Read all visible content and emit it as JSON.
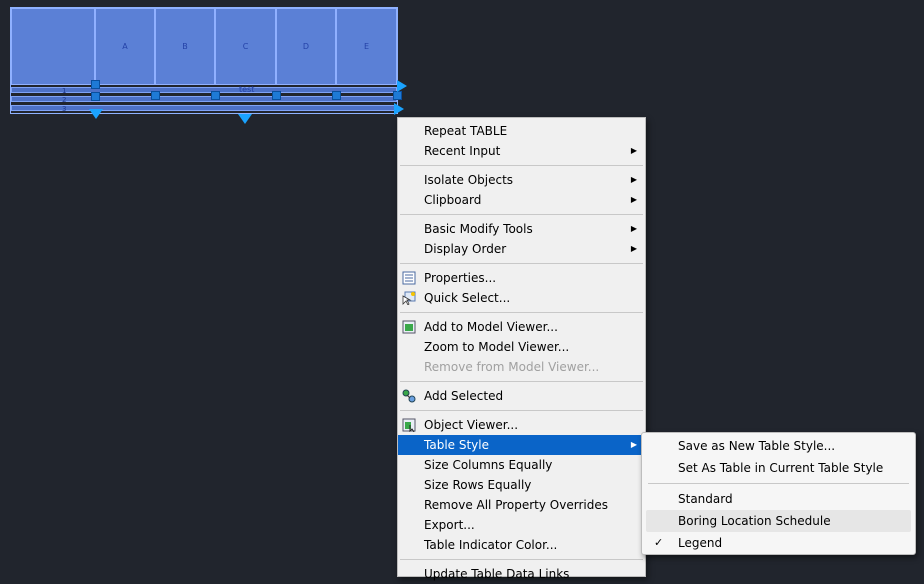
{
  "table": {
    "columns": [
      "A",
      "B",
      "C",
      "D",
      "E"
    ],
    "rows": [
      "1",
      "2",
      "3"
    ],
    "cell_text": "test"
  },
  "context_menu": {
    "items": [
      {
        "label": "Repeat TABLE"
      },
      {
        "label": "Recent Input",
        "submenu": true
      },
      {
        "label": "Isolate Objects",
        "submenu": true
      },
      {
        "label": "Clipboard",
        "submenu": true
      },
      {
        "label": "Basic Modify Tools",
        "submenu": true
      },
      {
        "label": "Display Order",
        "submenu": true
      },
      {
        "label": "Properties...",
        "icon": "properties-icon"
      },
      {
        "label": "Quick Select...",
        "icon": "quick-select-icon"
      },
      {
        "label": "Add to Model Viewer...",
        "icon": "model-viewer-icon"
      },
      {
        "label": "Zoom to Model Viewer..."
      },
      {
        "label": "Remove from Model Viewer...",
        "disabled": true
      },
      {
        "label": "Add Selected",
        "icon": "add-selected-icon"
      },
      {
        "label": "Object Viewer...",
        "icon": "object-viewer-icon"
      },
      {
        "label": "Table Style",
        "submenu": true,
        "active": true
      },
      {
        "label": "Size Columns Equally"
      },
      {
        "label": "Size Rows Equally"
      },
      {
        "label": "Remove All Property Overrides"
      },
      {
        "label": "Export..."
      },
      {
        "label": "Table Indicator Color..."
      },
      {
        "label": "Update Table Data Links"
      }
    ]
  },
  "table_style_submenu": {
    "items": [
      {
        "label": "Save as New Table Style..."
      },
      {
        "label": "Set As Table in Current Table Style"
      },
      {
        "label": "Standard"
      },
      {
        "label": "Boring Location Schedule",
        "hovered": true
      },
      {
        "label": "Legend",
        "checked": true
      }
    ]
  },
  "colors": {
    "canvas_background": "#21252d",
    "selection_fill": "#5b80d6",
    "grip": "#1e7ad6",
    "menu_highlight": "#0a64c8"
  }
}
